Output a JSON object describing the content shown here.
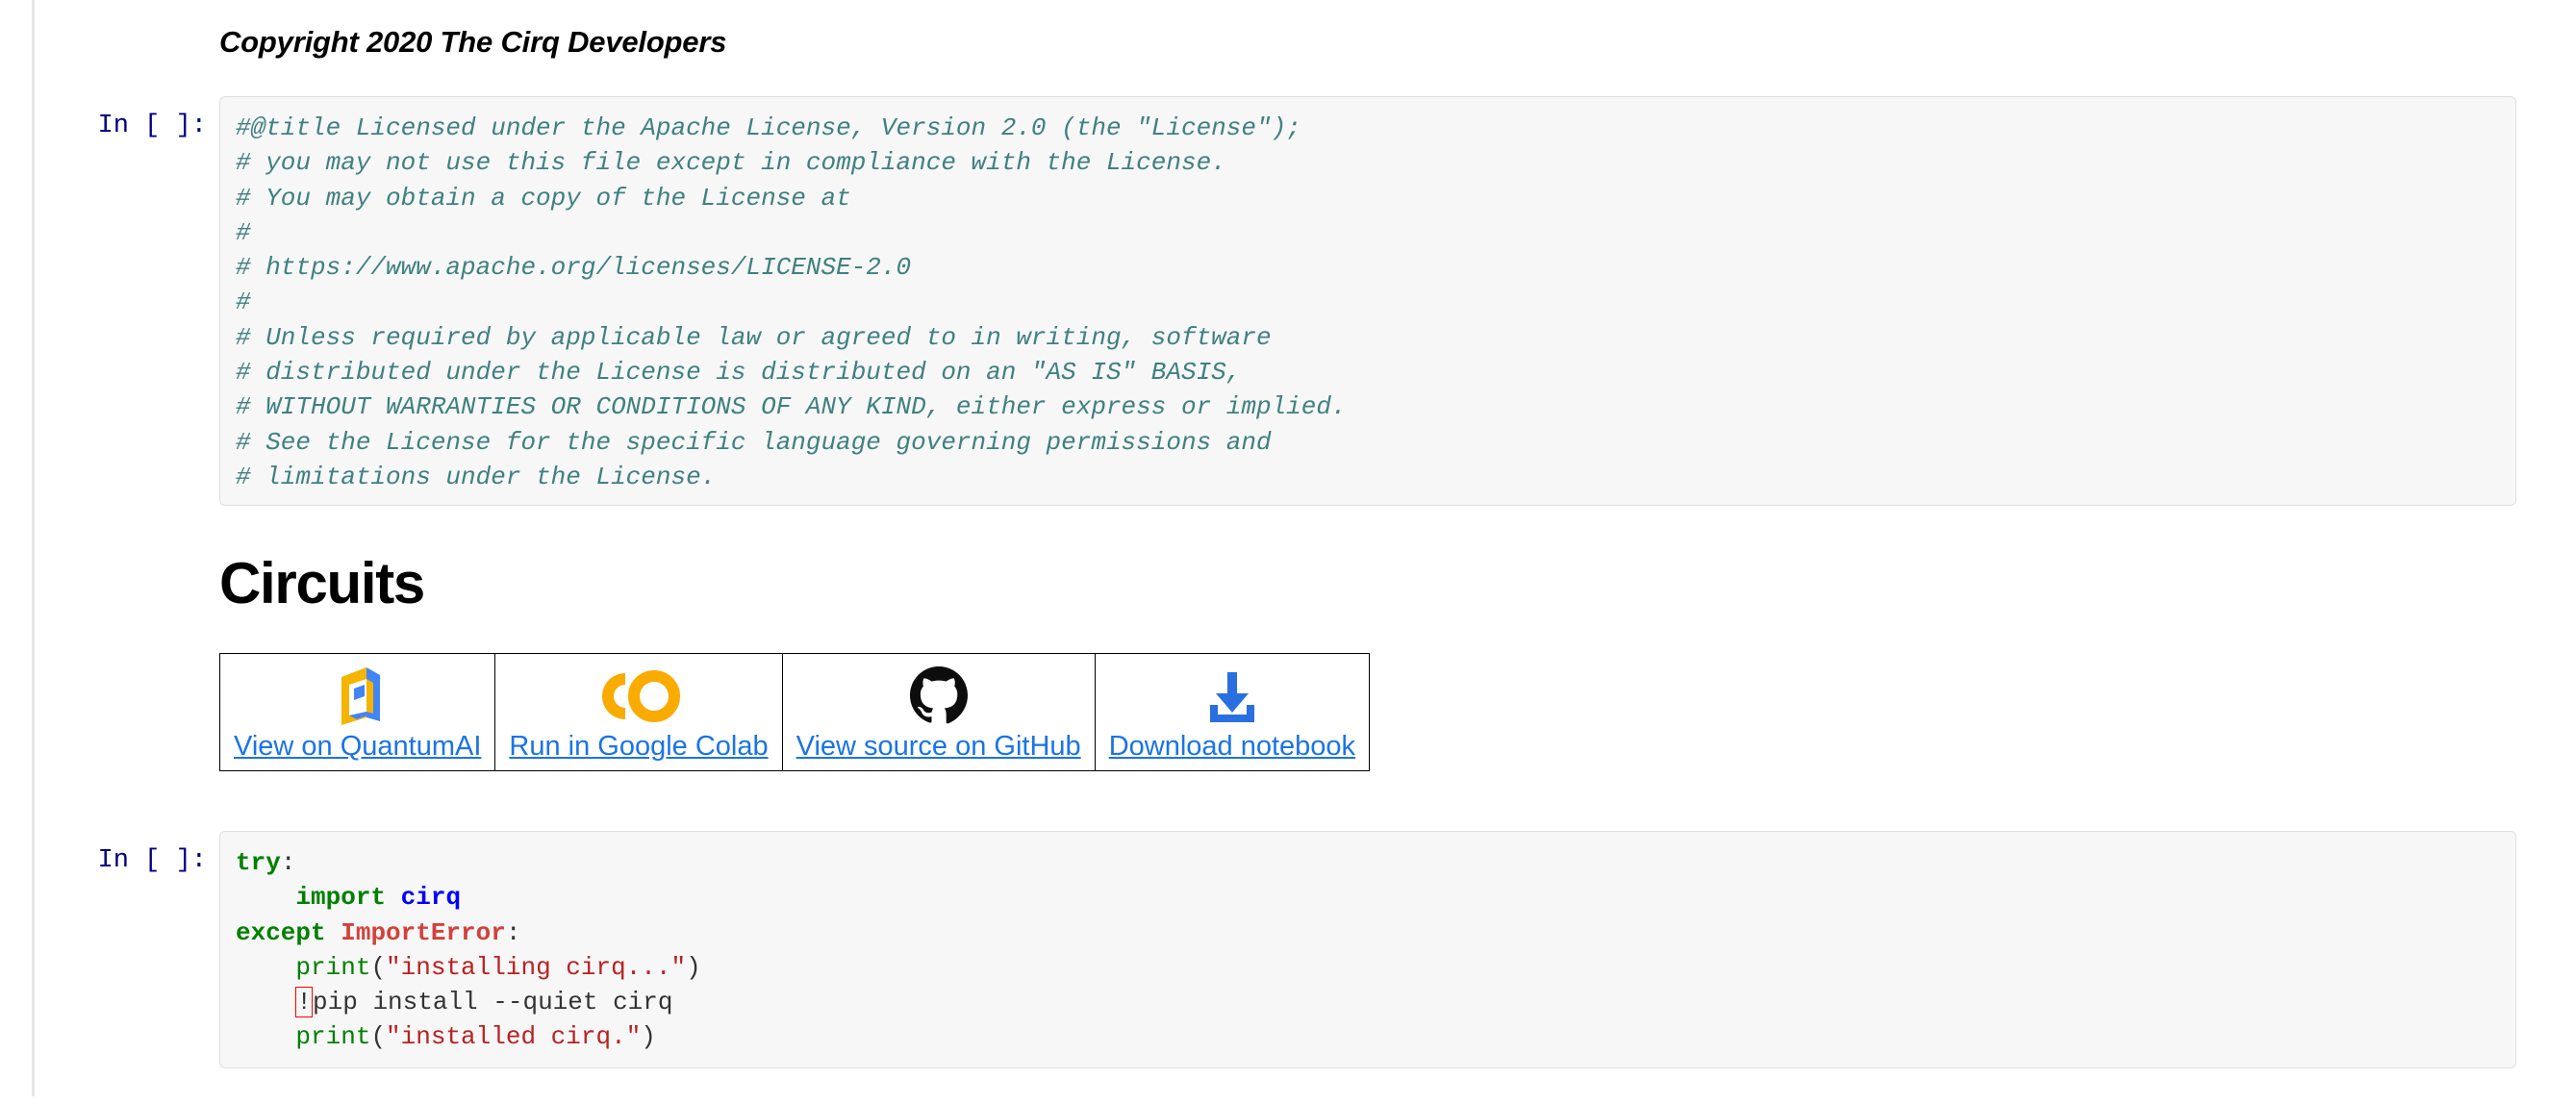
{
  "notebook": {
    "markdown_heading": "Copyright 2020 The Cirq Developers",
    "section_title": "Circuits",
    "cells": [
      {
        "prompt": "In [ ]:",
        "lines": [
          "#@title Licensed under the Apache License, Version 2.0 (the \"License\");",
          "# you may not use this file except in compliance with the License.",
          "# You may obtain a copy of the License at",
          "#",
          "# https://www.apache.org/licenses/LICENSE-2.0",
          "#",
          "# Unless required by applicable law or agreed to in writing, software",
          "# distributed under the License is distributed on an \"AS IS\" BASIS,",
          "# WITHOUT WARRANTIES OR CONDITIONS OF ANY KIND, either express or implied.",
          "# See the License for the specific language governing permissions and",
          "# limitations under the License."
        ]
      },
      {
        "prompt": "In [ ]:",
        "code_tokens": {
          "l1_try": "try",
          "l1_colon": ":",
          "l2_indent": "    ",
          "l2_import": "import",
          "l2_space": " ",
          "l2_module": "cirq",
          "l3_except": "except",
          "l3_space": " ",
          "l3_error": "ImportError",
          "l3_colon": ":",
          "l4_indent": "    ",
          "l4_print": "print",
          "l4_paren_open": "(",
          "l4_string": "\"installing cirq...\"",
          "l4_paren_close": ")",
          "l5_indent": "    ",
          "l5_bang": "!",
          "l5_rest": "pip install --quiet cirq",
          "l6_indent": "    ",
          "l6_print": "print",
          "l6_paren_open": "(",
          "l6_string": "\"installed cirq.\"",
          "l6_paren_close": ")"
        }
      }
    ]
  },
  "buttons": [
    {
      "icon": "quantumai-logo-icon",
      "label": "View on QuantumAI"
    },
    {
      "icon": "google-colab-icon",
      "label": "Run in Google Colab"
    },
    {
      "icon": "github-icon",
      "label": "View source on GitHub"
    },
    {
      "icon": "download-icon",
      "label": "Download notebook"
    }
  ],
  "colors": {
    "link": "#1a73e8",
    "prompt": "#000080",
    "comment": "#408080",
    "keyword": "#008000",
    "exception": "#d2413a",
    "string": "#ba2121",
    "module": "#0000ff",
    "error_box": "#ff0000",
    "cell_background": "#f7f7f7"
  }
}
